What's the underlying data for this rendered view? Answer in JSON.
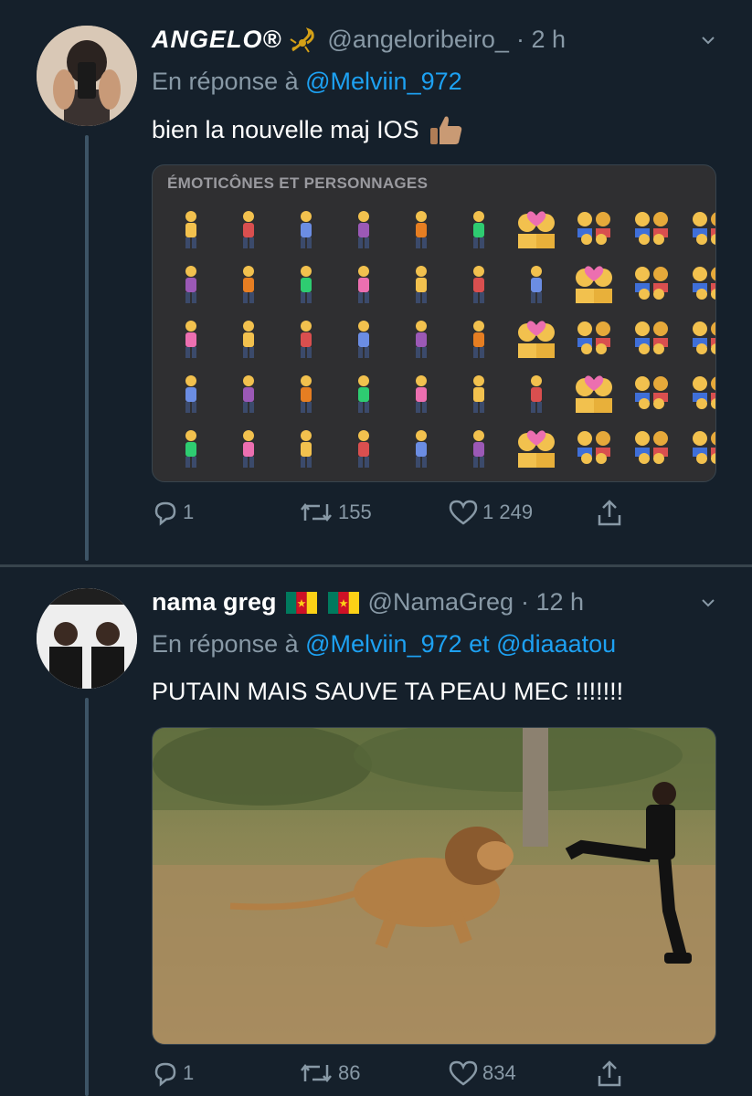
{
  "tweets": [
    {
      "display_name": "ANGELO®",
      "handle": "@angeloribeiro_",
      "time": "· 2 h",
      "reply_prefix": "En réponse à",
      "reply_mentions": "@Melviin_972",
      "text": "bien la nouvelle maj IOS",
      "media_title": "ÉMOTICÔNES ET PERSONNAGES",
      "replies": "1",
      "retweets": "155",
      "likes": "1 249"
    },
    {
      "display_name": "nama greg",
      "handle": "@NamaGreg",
      "time": "· 12 h",
      "reply_prefix": "En réponse à",
      "reply_mentions": "@Melviin_972 et @diaaatou",
      "text": "PUTAIN MAIS SAUVE TA PEAU MEC !!!!!!!",
      "replies": "1",
      "retweets": "86",
      "likes": "834"
    }
  ],
  "colors": {
    "background": "#15202b",
    "secondary_text": "#8899a6",
    "link": "#1da1f2",
    "divider": "#38444d"
  },
  "icons": [
    "scorpion-icon",
    "thumbs-up-icon",
    "cameroon-flag-icon",
    "reply-icon",
    "retweet-icon",
    "like-icon",
    "share-icon",
    "chevron-down-icon"
  ]
}
